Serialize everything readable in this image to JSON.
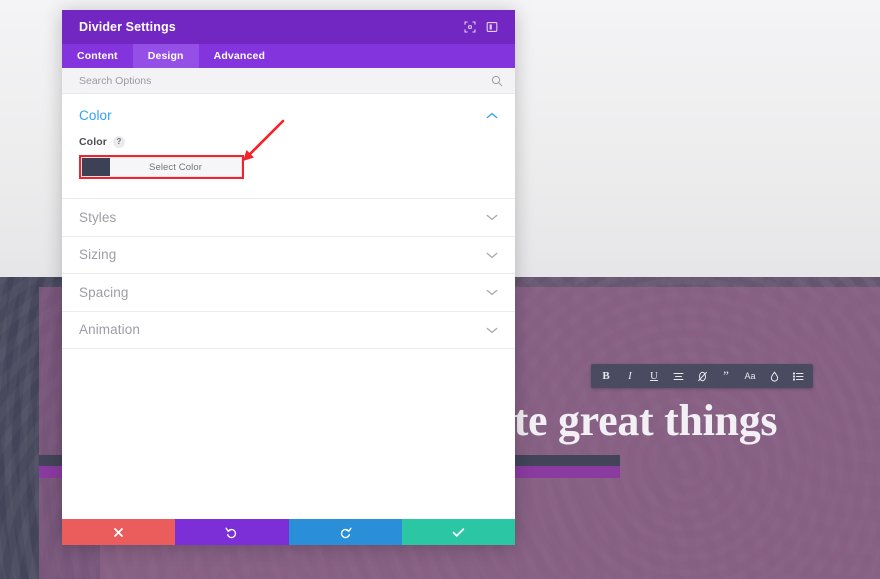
{
  "modal": {
    "title": "Divider Settings",
    "header_icons": [
      {
        "name": "expand-icon",
        "glyph": "expand"
      },
      {
        "name": "split-view-icon",
        "glyph": "panel"
      }
    ],
    "tabs": [
      {
        "label": "Content",
        "active": false
      },
      {
        "label": "Design",
        "active": true
      },
      {
        "label": "Advanced",
        "active": false
      }
    ],
    "search": {
      "placeholder": "Search Options",
      "value": "",
      "icon": "search-icon"
    },
    "color_section": {
      "title": "Color",
      "expanded": true,
      "chevron": "chevron-up-icon",
      "field": {
        "label": "Color",
        "help": "?",
        "swatch_color": "#3d4155",
        "button_label": "Select Color"
      }
    },
    "sections": [
      {
        "label": "Styles",
        "chevron": "chevron-down-icon"
      },
      {
        "label": "Sizing",
        "chevron": "chevron-down-icon"
      },
      {
        "label": "Spacing",
        "chevron": "chevron-down-icon"
      },
      {
        "label": "Animation",
        "chevron": "chevron-down-icon"
      }
    ],
    "footer": [
      {
        "name": "cancel-button",
        "icon": "close-icon",
        "color": "#eb5d5d"
      },
      {
        "name": "undo-button",
        "icon": "undo-icon",
        "color": "#7c2fd6"
      },
      {
        "name": "redo-button",
        "icon": "redo-icon",
        "color": "#2a8fd8"
      },
      {
        "name": "save-button",
        "icon": "check-icon",
        "color": "#2bc6a4"
      }
    ],
    "accent_colors": {
      "header_purple": "#7327c2",
      "tab_bar_purple": "#8334dd",
      "tab_active_purple": "#9450e6",
      "section_blue": "#2ea3f2",
      "annotation_red": "#f3232b"
    }
  },
  "page": {
    "hero_title": "ate great things",
    "hero_band_color": "#434459",
    "hero_overlay_color": "#96618e",
    "divider_dark_color": "#434459",
    "divider_purple_color": "#8a3ba0",
    "format_toolbar": [
      {
        "name": "bold-icon",
        "glyph": "B"
      },
      {
        "name": "italic-icon",
        "glyph": "I"
      },
      {
        "name": "underline-icon",
        "glyph": "U"
      },
      {
        "name": "align-icon",
        "glyph": "align"
      },
      {
        "name": "link-icon",
        "glyph": "link"
      },
      {
        "name": "quote-icon",
        "glyph": "quote"
      },
      {
        "name": "font-size-icon",
        "glyph": "Aa"
      },
      {
        "name": "text-color-icon",
        "glyph": "drop"
      },
      {
        "name": "list-icon",
        "glyph": "list"
      }
    ]
  },
  "annotation": {
    "arrow": "red-arrow-pointing-to-select-color"
  }
}
